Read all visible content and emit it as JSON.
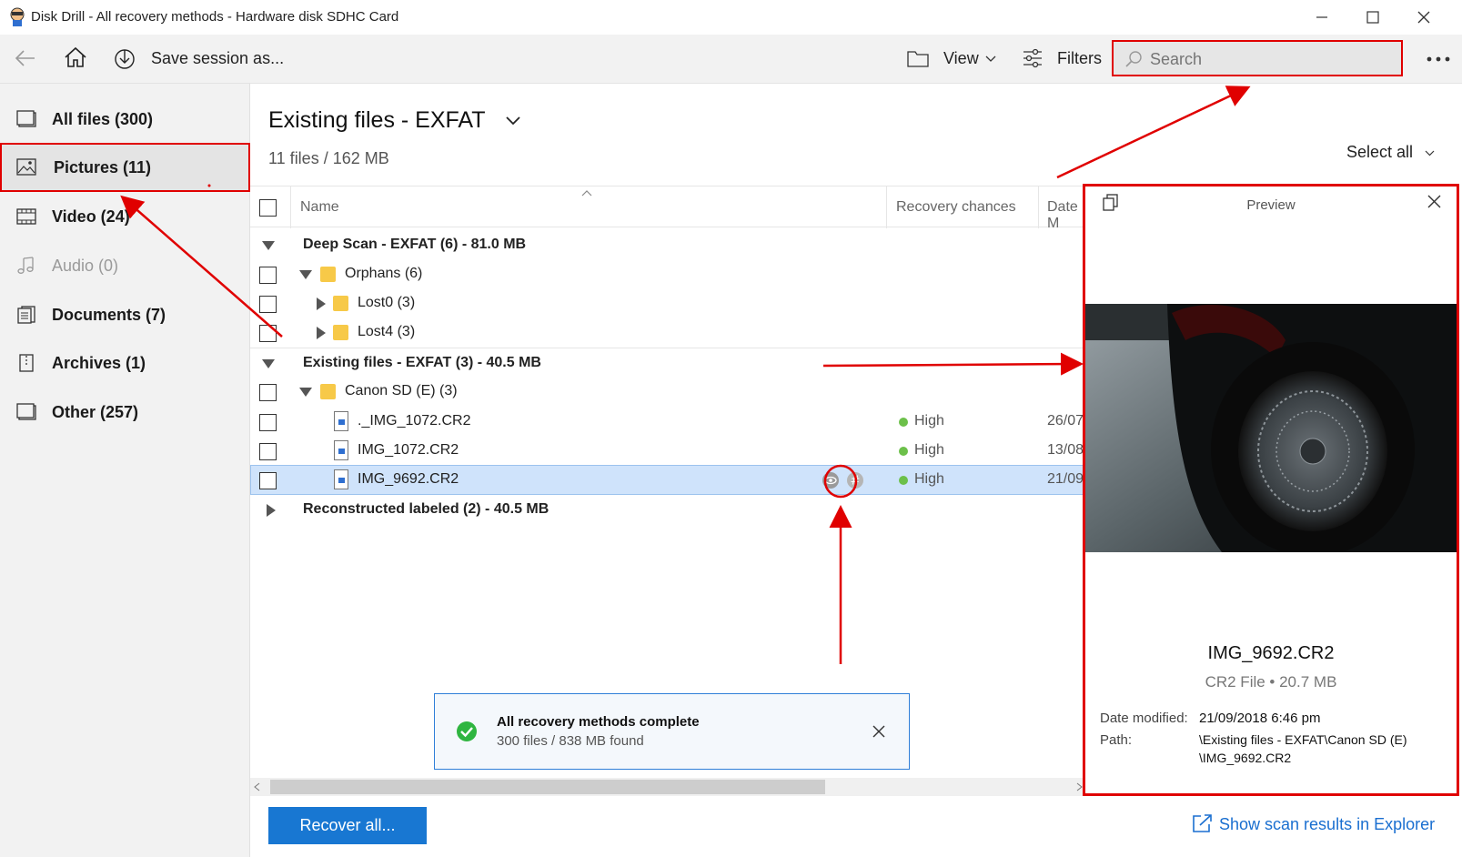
{
  "window": {
    "title": "Disk Drill - All recovery methods - Hardware disk SDHC Card"
  },
  "toolbar": {
    "save_session": "Save session as...",
    "view": "View",
    "filters": "Filters",
    "search_placeholder": "Search"
  },
  "sidebar": {
    "items": [
      {
        "label": "All files (300)",
        "icon": "files-icon"
      },
      {
        "label": "Pictures (11)",
        "icon": "picture-icon"
      },
      {
        "label": "Video (24)",
        "icon": "film-icon"
      },
      {
        "label": "Audio (0)",
        "icon": "music-note-icon"
      },
      {
        "label": "Documents (7)",
        "icon": "document-icon"
      },
      {
        "label": "Archives (1)",
        "icon": "archive-icon"
      },
      {
        "label": "Other (257)",
        "icon": "other-files-icon"
      }
    ]
  },
  "main": {
    "title": "Existing files - EXFAT",
    "summary": "11 files / 162 MB",
    "select_all": "Select all",
    "columns": {
      "name": "Name",
      "recovery": "Recovery chances",
      "date": "Date M"
    },
    "rows": {
      "deep_scan": "Deep Scan - EXFAT (6) - 81.0 MB",
      "orphans": "Orphans (6)",
      "lost0": "Lost0 (3)",
      "lost4": "Lost4 (3)",
      "existing": "Existing files - EXFAT (3) - 40.5 MB",
      "canon": "Canon SD (E) (3)",
      "file1": {
        "name": "._IMG_1072.CR2",
        "recovery": "High",
        "date": "26/07/"
      },
      "file2": {
        "name": "IMG_1072.CR2",
        "recovery": "High",
        "date": "13/08/"
      },
      "file3": {
        "name": "IMG_9692.CR2",
        "recovery": "High",
        "date": "21/09/"
      },
      "reconstructed": "Reconstructed labeled (2) - 40.5 MB"
    }
  },
  "toast": {
    "title": "All recovery methods complete",
    "detail": "300 files / 838 MB found"
  },
  "bottom": {
    "recover_all": "Recover all...",
    "explorer_link": "Show scan results in Explorer"
  },
  "preview": {
    "header": "Preview",
    "file_name": "IMG_9692.CR2",
    "file_info": "CR2 File • 20.7 MB",
    "date_label": "Date modified:",
    "date_value": "21/09/2018 6:46 pm",
    "path_label": "Path:",
    "path_value_1": "\\Existing files - EXFAT\\Canon SD (E)",
    "path_value_2": "\\IMG_9692.CR2"
  },
  "colors": {
    "accent": "#1877d2",
    "annotation": "#e00000",
    "high": "#6cc04a",
    "selected_row": "#cfe3fb"
  }
}
